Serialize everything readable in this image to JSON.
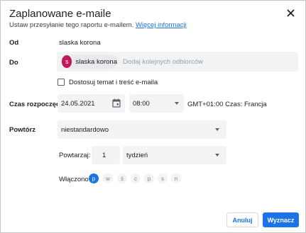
{
  "dialog": {
    "title": "Zaplanowane e-maile",
    "subtitle": "Ustaw przesyłanie tego raportu e-mailem.",
    "more_info_link": "Więcej informacji"
  },
  "from": {
    "label": "Od",
    "value": "slaska korona"
  },
  "to": {
    "label": "Do",
    "recipient": {
      "initial": "s",
      "name": "slaska korona",
      "avatar_color": "#c2185b"
    },
    "placeholder": "Dodaj kolejnych odbiorców"
  },
  "customize": {
    "label": "Dostosuj temat i treść e-maila",
    "checked": false
  },
  "start": {
    "label": "Czas rozpoczęcia",
    "date": "24.05.2021",
    "time": "08:00",
    "timezone": "GMT+01:00 Czas: Francja"
  },
  "repeat": {
    "label": "Powtórz",
    "selected": "niestandardowo",
    "every_label": "Powtarzaj:",
    "every_value": "1",
    "unit": "tydzień",
    "on_label": "Włączono",
    "days": [
      {
        "label": "p",
        "active": true
      },
      {
        "label": "w",
        "active": false
      },
      {
        "label": "ś",
        "active": false
      },
      {
        "label": "c",
        "active": false
      },
      {
        "label": "p",
        "active": false
      },
      {
        "label": "s",
        "active": false
      },
      {
        "label": "n",
        "active": false
      }
    ]
  },
  "actions": {
    "cancel": "Anuluj",
    "schedule": "Wyznacz"
  },
  "colors": {
    "accent": "#1a73e8",
    "field_bg": "#f1f3f4"
  }
}
